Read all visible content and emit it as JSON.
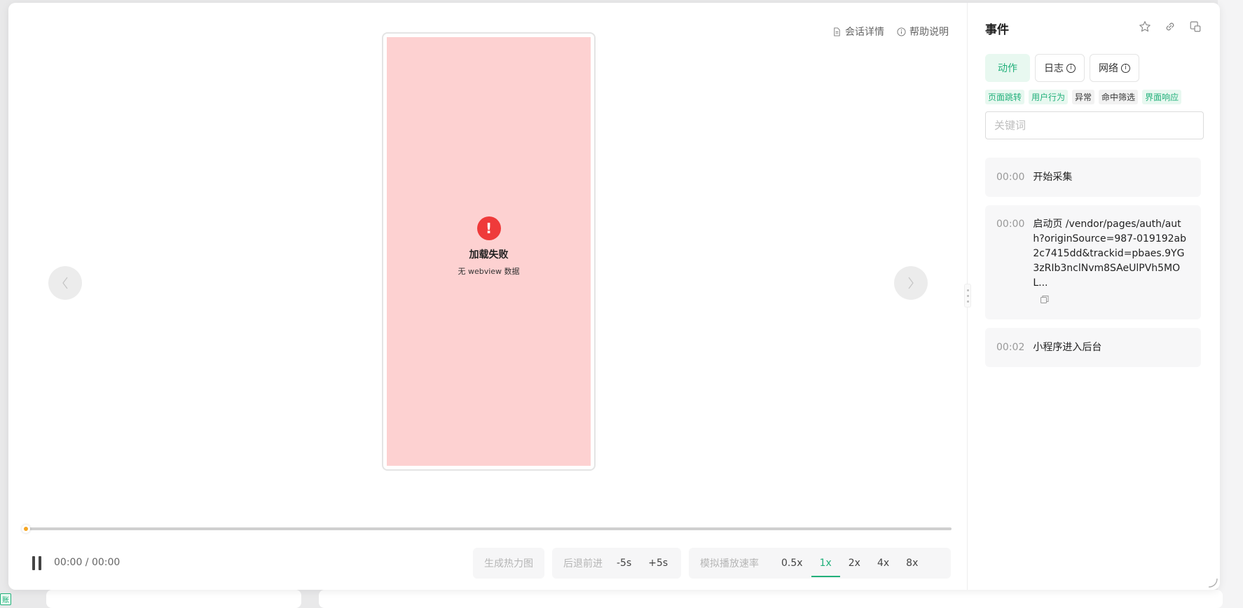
{
  "header_links": {
    "session_details": "会话详情",
    "help": "帮助说明"
  },
  "phone": {
    "error_title": "加载失败",
    "error_subtitle": "无 webview 数据",
    "error_icon": "!"
  },
  "player": {
    "time": "00:00 / 00:00",
    "progress": 0,
    "heatmap_label": "生成热力图",
    "seek_label": "后退前进",
    "seek_back": "-5s",
    "seek_forward": "+5s",
    "speed_label": "模拟播放速率",
    "speeds": [
      "0.5x",
      "1x",
      "2x",
      "4x",
      "8x"
    ],
    "active_speed": "1x"
  },
  "events": {
    "title": "事件",
    "tabs": [
      {
        "label": "动作",
        "active": true
      },
      {
        "label": "日志",
        "active": false
      },
      {
        "label": "网络",
        "active": false
      }
    ],
    "filters": [
      {
        "label": "页面跳转",
        "on": true
      },
      {
        "label": "用户行为",
        "on": true
      },
      {
        "label": "异常",
        "on": false
      },
      {
        "label": "命中筛选",
        "on": false
      },
      {
        "label": "界面响应",
        "on": true
      }
    ],
    "search_placeholder": "关键词",
    "items": [
      {
        "time": "00:00",
        "text": "开始采集"
      },
      {
        "time": "00:00",
        "text": "启动页 /vendor/pages/auth/auth?originSource=987-019192ab2c7415dd&trackid=pbaes.9YG3zRIb3nclNvm8SAeUlPVh5MOL..."
      },
      {
        "time": "00:02",
        "text": "小程序进入后台"
      }
    ]
  },
  "colors": {
    "accent": "#21b07a",
    "error": "#ef3a3a",
    "phone_screen": "#fdd1d1",
    "progress_dot": "#f5a623"
  }
}
